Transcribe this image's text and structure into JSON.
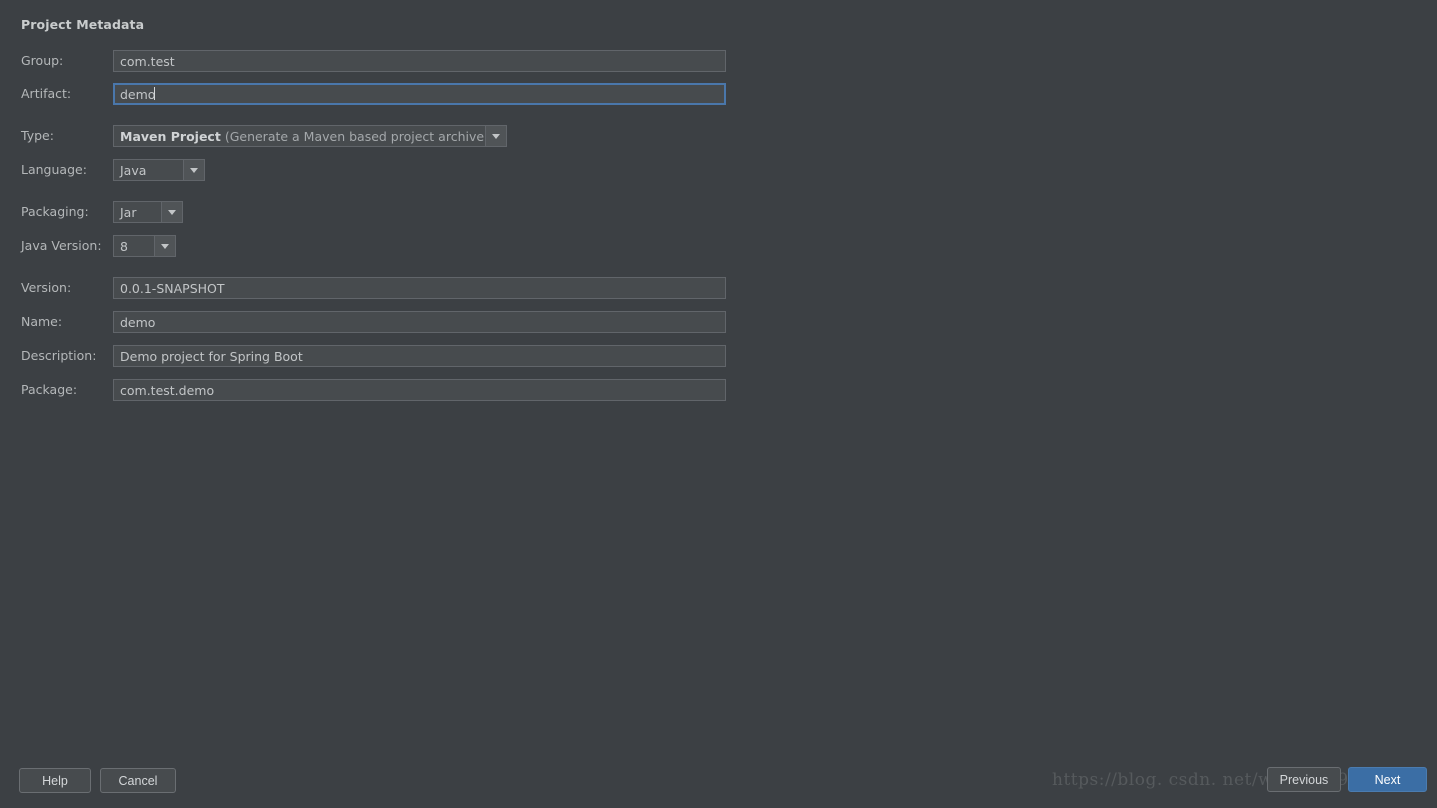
{
  "dialog": {
    "section_title": "Project Metadata",
    "background_color": "#3c4044",
    "field_background_color": "#474b4e",
    "focus_border_color": "#4a77ab",
    "primary_button_color": "#3b6ea5"
  },
  "fields": {
    "group": {
      "label": "Group:",
      "value": "com.test"
    },
    "artifact": {
      "label": "Artifact:",
      "value": "demo",
      "focused": true
    },
    "type": {
      "label": "Type:",
      "value_strong": "Maven Project",
      "value_dim": "(Generate a Maven based project archive)",
      "value": "Maven Project (Generate a Maven based project archive)"
    },
    "language": {
      "label": "Language:",
      "value": "Java"
    },
    "packaging": {
      "label": "Packaging:",
      "value": "Jar"
    },
    "java_version": {
      "label": "Java Version:",
      "value": "8"
    },
    "version": {
      "label": "Version:",
      "value": "0.0.1-SNAPSHOT"
    },
    "name": {
      "label": "Name:",
      "value": "demo"
    },
    "description": {
      "label": "Description:",
      "value": "Demo project for Spring Boot"
    },
    "package": {
      "label": "Package:",
      "value": "com.test.demo"
    }
  },
  "buttons": {
    "help": "Help",
    "cancel": "Cancel",
    "previous": "Previous",
    "next": "Next"
  },
  "watermark": {
    "text": "https://blog. csdn. net/weixin_39216383"
  }
}
